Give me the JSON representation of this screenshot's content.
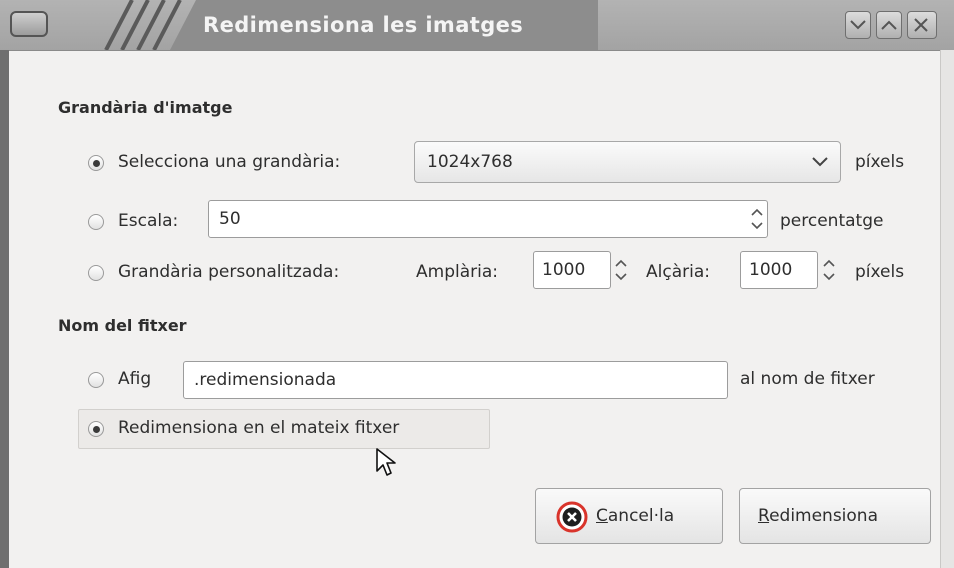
{
  "window": {
    "title": "Redimensiona les imatges"
  },
  "image_size": {
    "heading": "Grandària d'imatge",
    "select_option": {
      "label": "Selecciona una grandària:",
      "value": "1024x768",
      "unit": "píxels",
      "selected": true
    },
    "scale_option": {
      "label": "Escala:",
      "value": "50",
      "unit": "percentatge",
      "selected": false
    },
    "custom_option": {
      "label": "Grandària personalitzada:",
      "width_label": "Amplària:",
      "width_value": "1000",
      "height_label": "Alçària:",
      "height_value": "1000",
      "unit": "píxels",
      "selected": false
    }
  },
  "file_name": {
    "heading": "Nom del fitxer",
    "append_option": {
      "label": "Afig",
      "value": ".redimensionada",
      "suffix": "al nom de fitxer",
      "selected": false
    },
    "same_file_option": {
      "label": "Redimensiona en el mateix fitxer",
      "selected": true
    }
  },
  "buttons": {
    "cancel": {
      "mnemonic": "C",
      "rest": "ancel·la"
    },
    "resize": {
      "mnemonic": "R",
      "rest": "edimensiona"
    }
  },
  "colors": {
    "title_text": "#f4f4f4",
    "titlebar": "#a8a8a8",
    "window_bg": "#f2f1f0",
    "cancel_icon_red": "#d9342b"
  }
}
